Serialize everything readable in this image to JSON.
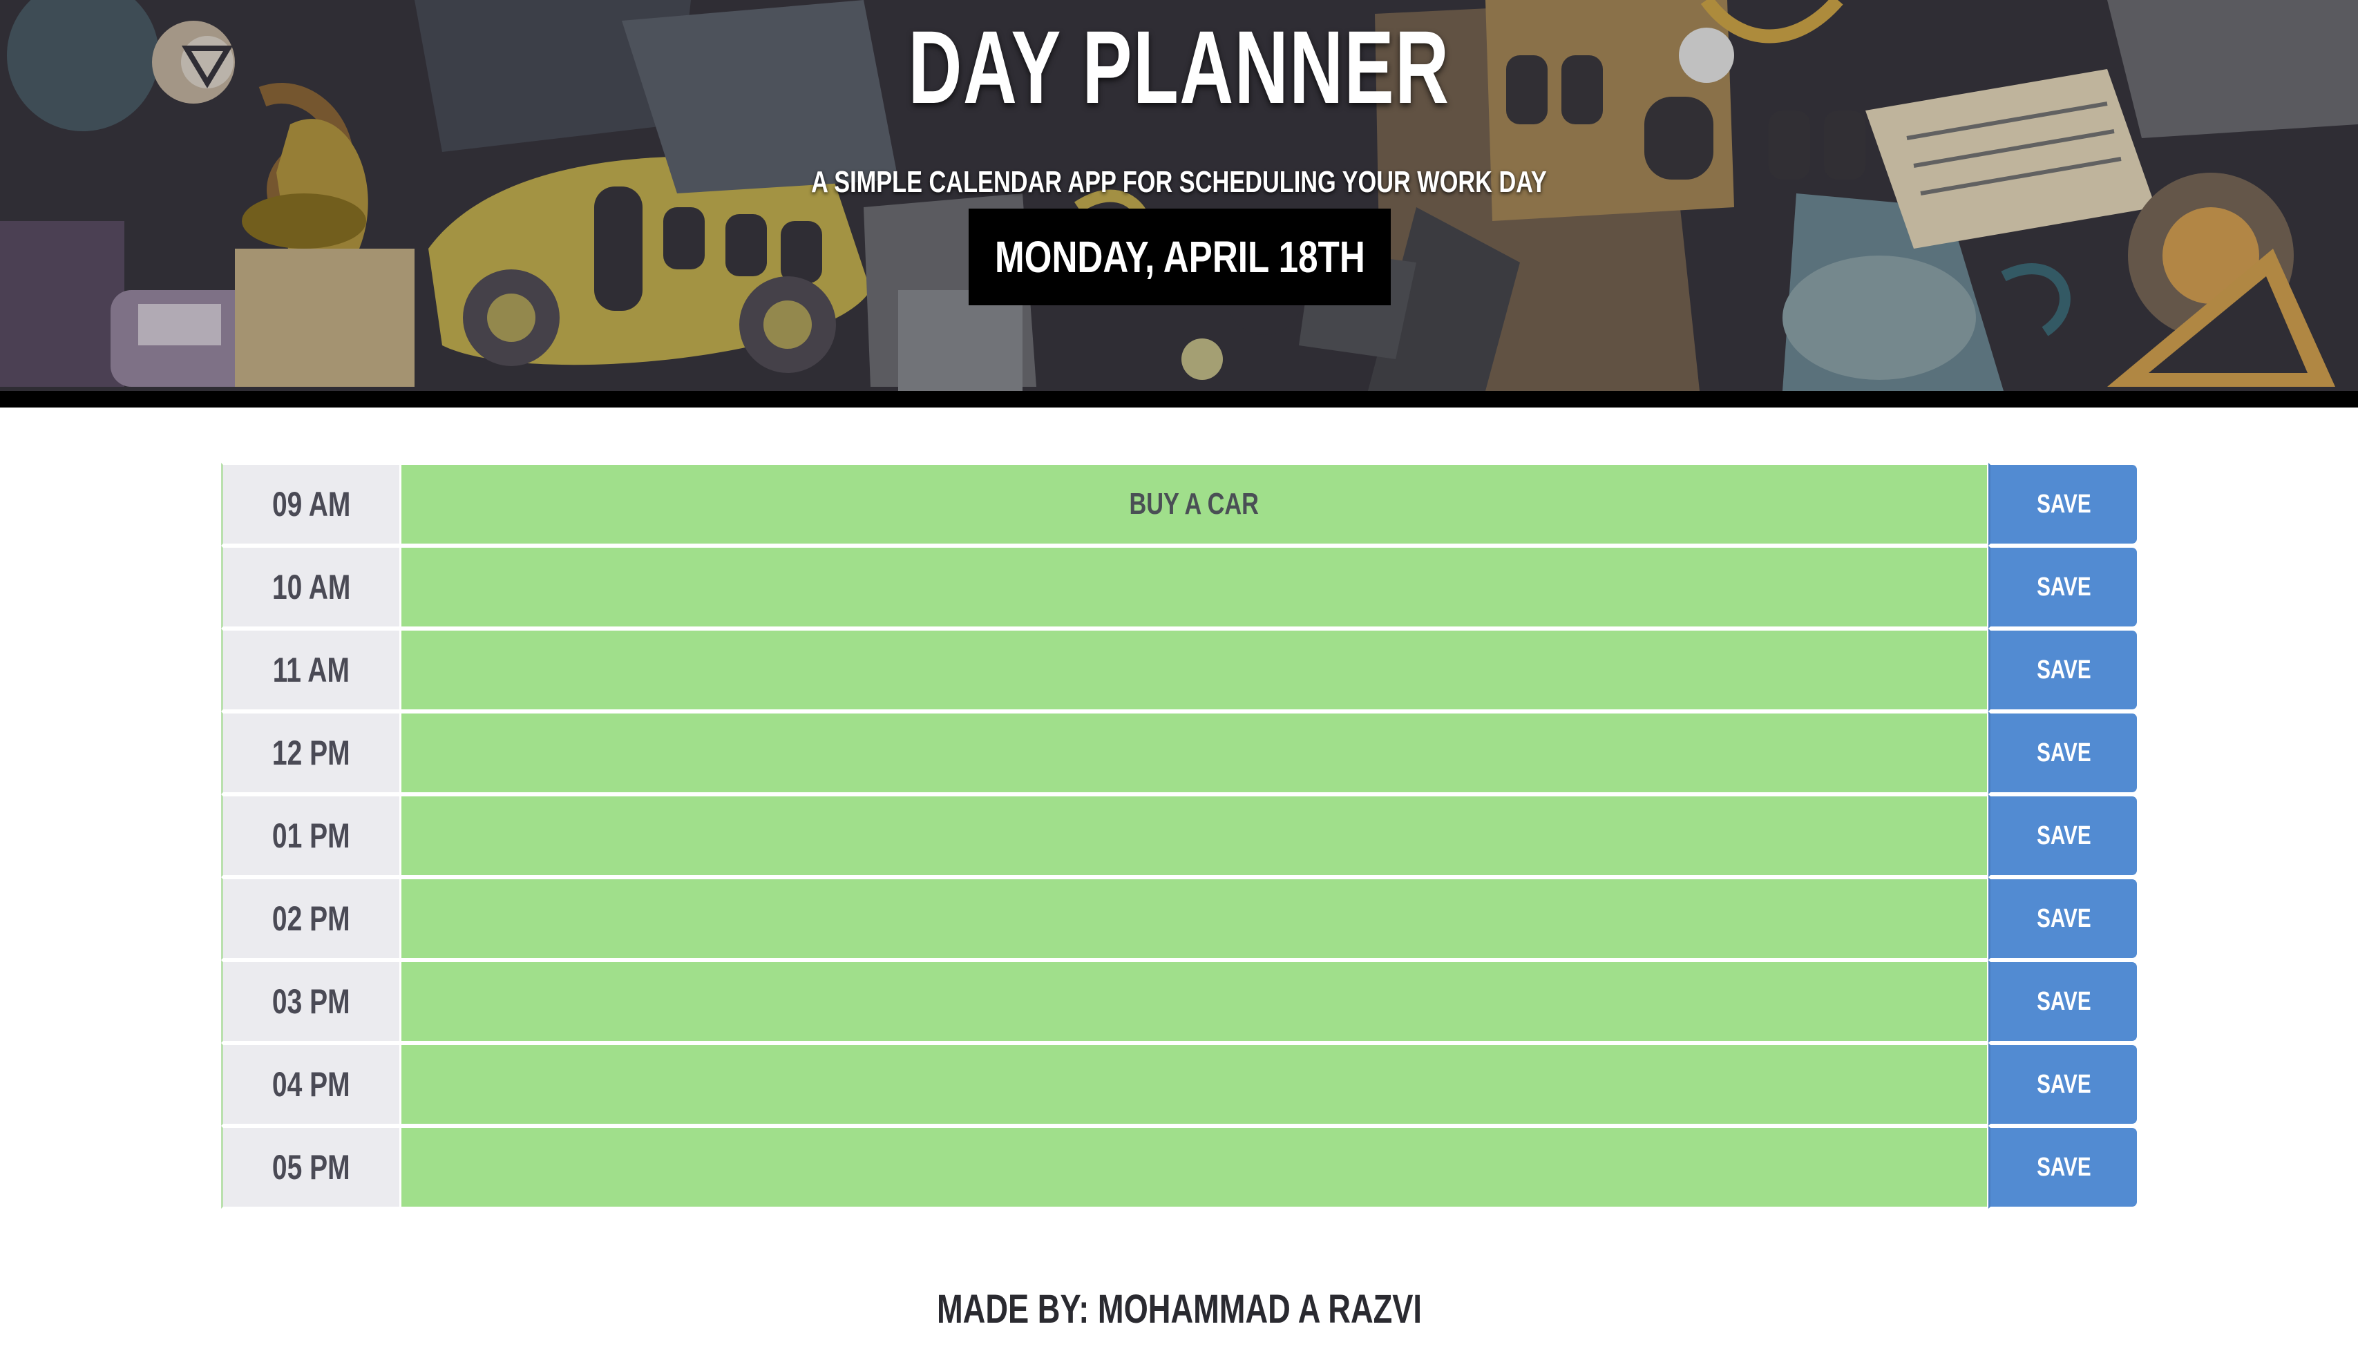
{
  "header": {
    "title": "DAY PLANNER",
    "subtitle": "A SIMPLE CALENDAR APP FOR SCHEDULING YOUR WORK DAY",
    "current_date": "MONDAY, APRIL 18TH"
  },
  "planner": {
    "rows": [
      {
        "hour": "09 AM",
        "task": "BUY A CAR",
        "save_label": "SAVE"
      },
      {
        "hour": "10 AM",
        "task": "",
        "save_label": "SAVE"
      },
      {
        "hour": "11 AM",
        "task": "",
        "save_label": "SAVE"
      },
      {
        "hour": "12 PM",
        "task": "",
        "save_label": "SAVE"
      },
      {
        "hour": "01 PM",
        "task": "",
        "save_label": "SAVE"
      },
      {
        "hour": "02 PM",
        "task": "",
        "save_label": "SAVE"
      },
      {
        "hour": "03 PM",
        "task": "",
        "save_label": "SAVE"
      },
      {
        "hour": "04 PM",
        "task": "",
        "save_label": "SAVE"
      },
      {
        "hour": "05 PM",
        "task": "",
        "save_label": "SAVE"
      }
    ]
  },
  "footer": {
    "credit": "MADE BY: MOHAMMAD A RAZVI"
  },
  "colors": {
    "future_slot": "#a0df8b",
    "save_button": "#528bd2",
    "hour_cell": "#ebebef",
    "date_box": "#000000"
  }
}
